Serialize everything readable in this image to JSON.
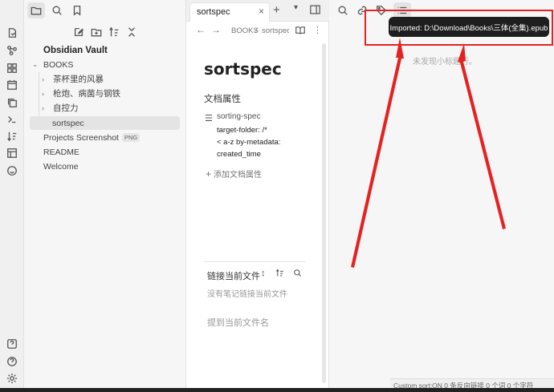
{
  "ribbon": {
    "icons": [
      "open-file-icon",
      "graph-icon",
      "plugins-icon",
      "calendar-icon",
      "copy-icon",
      "terminal-icon",
      "sort-icon",
      "table-icon",
      "smiley-icon",
      "help-box-icon",
      "help-icon",
      "settings-icon"
    ]
  },
  "sidebar": {
    "vault_name": "Obsidian Vault",
    "items": [
      {
        "label": "BOOKS",
        "chevron": "⌄"
      },
      {
        "label": "茶杯里的风暴",
        "chevron": "›"
      },
      {
        "label": "枪炮、病菌与钢铁",
        "chevron": "›"
      },
      {
        "label": "自控力",
        "chevron": "›"
      },
      {
        "label": "sortspec",
        "chevron": ""
      },
      {
        "label": "Projects Screenshot",
        "chevron": "",
        "badge": "PNG"
      },
      {
        "label": "README",
        "chevron": ""
      },
      {
        "label": "Welcome",
        "chevron": ""
      }
    ]
  },
  "editor": {
    "tab_title": "sortspec",
    "tab_close": "×",
    "new_tab": "+",
    "breadcrumb_folder": "BOOKS",
    "breadcrumb_sep": "/",
    "breadcrumb_file": "sortspec",
    "nav_back": "←",
    "nav_forward": "→",
    "more": "⋮",
    "doc_title": "sortspec",
    "properties_heading": "文档属性",
    "property_key": "sorting-spec",
    "property_values": [
      "target-folder: /*",
      "< a-z by-metadata:",
      "created_time"
    ],
    "add_property": "添加文档属性",
    "add_property_icon": "+",
    "backlinks_title": "链接当前文件",
    "no_backlinks": "没有笔记链接当前文件",
    "unlinked_mentions": "提到当前文件名"
  },
  "right_panel": {
    "no_headings": "未发现小标题行。"
  },
  "notice": {
    "text": "Imported: D:\\Download\\Books\\三体(全集).epub"
  },
  "status_bar": {
    "text": "Custom sort:ON   0 条反向链接   0 个词   0 个字符"
  },
  "colors": {
    "annotation_red": "#e52222",
    "notice_bg": "#1e1e1e"
  }
}
